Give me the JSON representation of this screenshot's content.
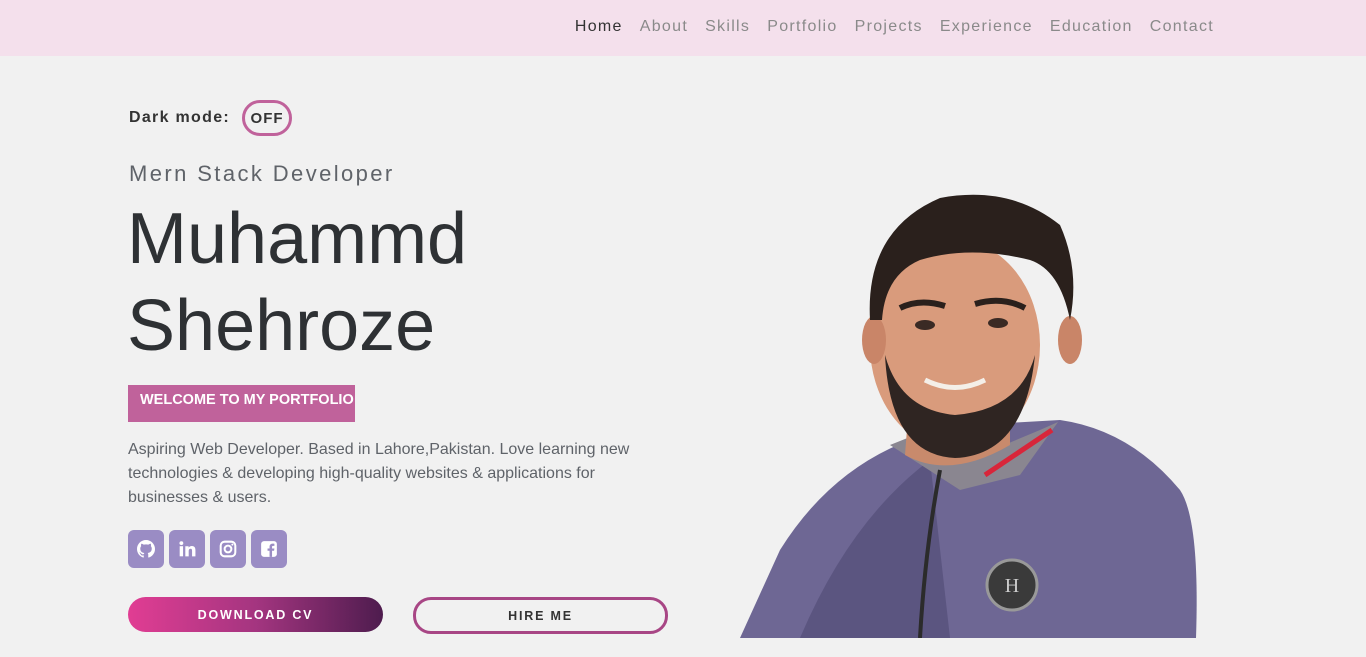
{
  "nav": {
    "items": [
      "Home",
      "About",
      "Skills",
      "Portfolio",
      "Projects",
      "Experience",
      "Education",
      "Contact"
    ],
    "active": "Home"
  },
  "dark_mode": {
    "label": "Dark mode:",
    "state": "OFF"
  },
  "hero": {
    "subtitle": "Mern Stack Developer",
    "name_line1": "Muhammd",
    "name_line2": "Shehroze",
    "welcome": "WELCOME TO MY PORTFOLIO",
    "bio": "Aspiring Web Developer. Based in Lahore,Pakistan. Love learning new technologies & developing high-quality websites & applications for businesses & users."
  },
  "socials": [
    {
      "icon": "github-icon"
    },
    {
      "icon": "linkedin-icon"
    },
    {
      "icon": "instagram-icon"
    },
    {
      "icon": "facebook-icon"
    }
  ],
  "buttons": {
    "download": "DOWNLOAD CV",
    "hire": "HIRE ME"
  },
  "colors": {
    "nav_bg": "#f4e0ec",
    "accent": "#c0629b",
    "social_bg": "#9a8cc4",
    "page_bg": "#f1f1f1",
    "text_dark": "#2e3134"
  }
}
